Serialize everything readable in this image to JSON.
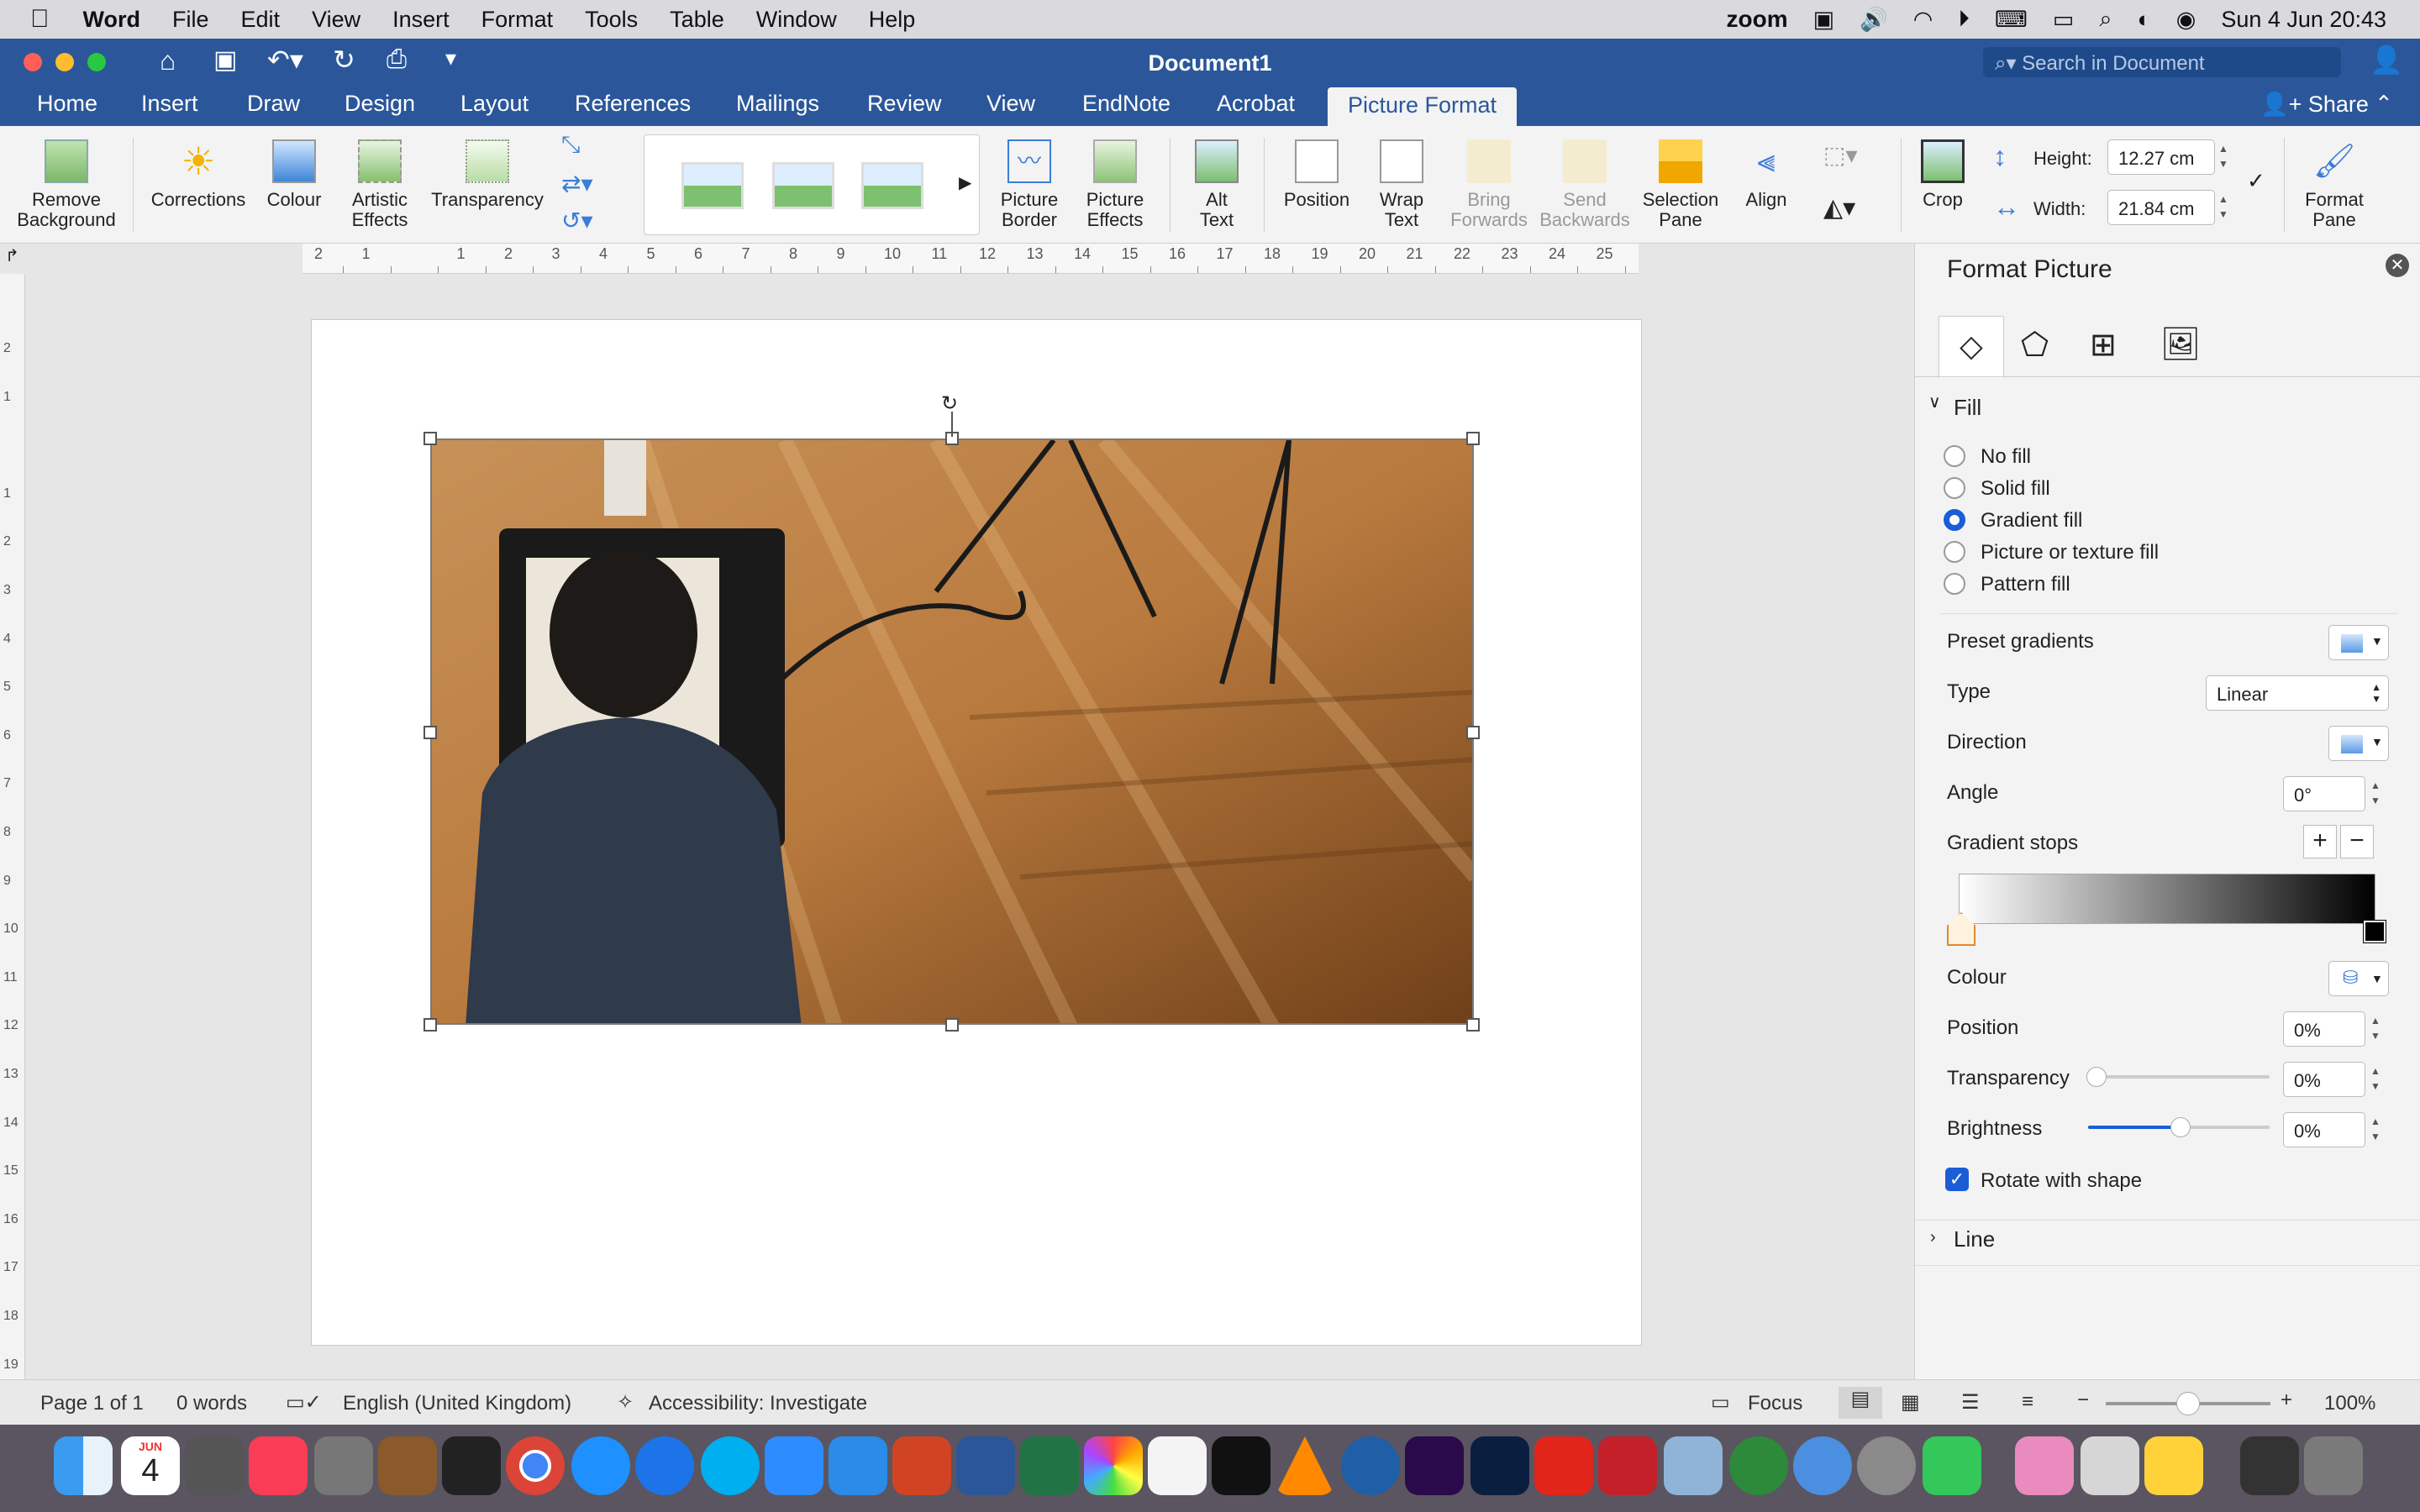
{
  "menubar": {
    "app": "Word",
    "items": [
      "File",
      "Edit",
      "View",
      "Insert",
      "Format",
      "Tools",
      "Table",
      "Window",
      "Help"
    ],
    "zoom": "zoom",
    "datetime": "Sun 4 Jun  20:43"
  },
  "title": {
    "doc": "Document1",
    "search_placeholder": "Search in Document"
  },
  "tabs": [
    "Home",
    "Insert",
    "Draw",
    "Design",
    "Layout",
    "References",
    "Mailings",
    "Review",
    "View",
    "EndNote",
    "Acrobat",
    "Picture Format"
  ],
  "share": "Share",
  "ribbon": {
    "remove_bg": "Remove Background",
    "corrections": "Corrections",
    "colour": "Colour",
    "artistic": "Artistic Effects",
    "transparency": "Transparency",
    "picture_border": "Picture Border",
    "picture_effects": "Picture Effects",
    "alt_text": "Alt Text",
    "position": "Position",
    "wrap_text": "Wrap Text",
    "bring_forwards": "Bring Forwards",
    "send_backwards": "Send Backwards",
    "selection_pane": "Selection Pane",
    "align": "Align",
    "crop": "Crop",
    "height_label": "Height:",
    "height": "12.27 cm",
    "width_label": "Width:",
    "width": "21.84 cm",
    "format_pane": "Format Pane"
  },
  "ruler": {
    "ticks": [
      "2",
      "1",
      "",
      "1",
      "2",
      "3",
      "4",
      "5",
      "6",
      "7",
      "8",
      "9",
      "10",
      "11",
      "12",
      "13",
      "14",
      "15",
      "16",
      "17",
      "18",
      "19",
      "20",
      "21",
      "22",
      "23",
      "24",
      "25"
    ],
    "vticks": [
      "2",
      "1",
      "",
      "1",
      "2",
      "3",
      "4",
      "5",
      "6",
      "7",
      "8",
      "9",
      "10",
      "11",
      "12",
      "13",
      "14",
      "15",
      "16",
      "17",
      "18",
      "19"
    ]
  },
  "pane": {
    "title": "Format Picture",
    "fill": "Fill",
    "options": [
      "No fill",
      "Solid fill",
      "Gradient fill",
      "Picture or texture fill",
      "Pattern fill"
    ],
    "preset": "Preset gradients",
    "type": "Type",
    "type_val": "Linear",
    "direction": "Direction",
    "angle": "Angle",
    "angle_val": "0°",
    "stops": "Gradient stops",
    "colour": "Colour",
    "position": "Position",
    "position_val": "0%",
    "transparency": "Transparency",
    "transparency_val": "0%",
    "brightness": "Brightness",
    "brightness_val": "0%",
    "rotate": "Rotate with shape",
    "line": "Line"
  },
  "status": {
    "page": "Page 1 of 1",
    "words": "0 words",
    "lang": "English (United Kingdom)",
    "access": "Accessibility: Investigate",
    "focus": "Focus",
    "zoom": "100%"
  },
  "dock": {
    "calendar_month": "JUN",
    "calendar_day": "4"
  }
}
